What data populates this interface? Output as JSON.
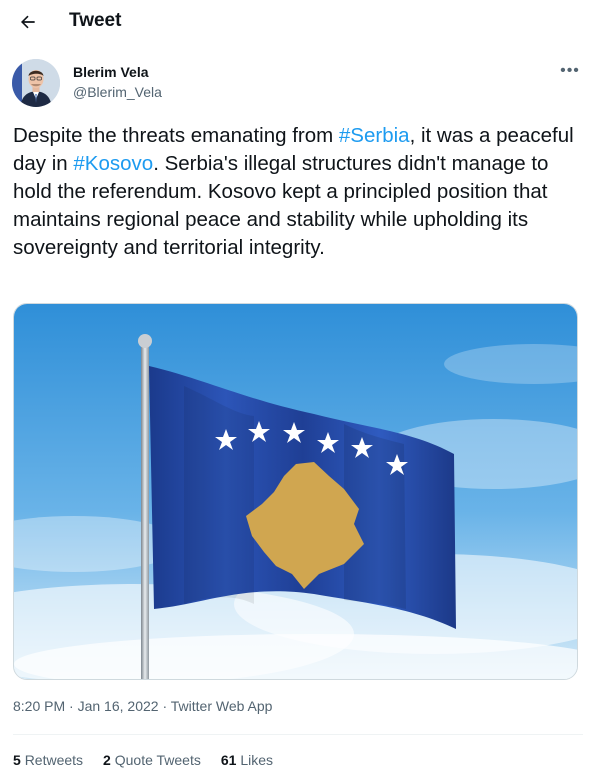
{
  "header": {
    "title": "Tweet",
    "back_icon": "arrow-left-icon"
  },
  "author": {
    "name": "Blerim Vela",
    "handle": "@Blerim_Vela",
    "more_icon": "more-horizontal-icon",
    "more_label": "•••"
  },
  "tweet": {
    "segments": [
      {
        "text": "Despite the threats emanating from ",
        "type": "text"
      },
      {
        "text": "#Serbia",
        "type": "hashtag"
      },
      {
        "text": ", it was a peaceful day in ",
        "type": "text"
      },
      {
        "text": "#Kosovo",
        "type": "hashtag"
      },
      {
        "text": ". Serbia's illegal structures didn't manage to hold the referendum. Kosovo kept a principled position that maintains regional peace and stability while upholding its sovereignty and territorial integrity.",
        "type": "text"
      }
    ]
  },
  "meta": {
    "time": "8:20 PM",
    "sep1": " · ",
    "date": "Jan 16, 2022",
    "sep2": " · ",
    "source": "Twitter Web App"
  },
  "stats": {
    "retweets_count": "5",
    "retweets_label": "Retweets",
    "quotes_count": "2",
    "quotes_label": "Quote Tweets",
    "likes_count": "61",
    "likes_label": "Likes"
  },
  "colors": {
    "accent": "#1d9bf0",
    "text": "#0f1419",
    "secondary": "#536471",
    "flag_blue": "#244aa5",
    "flag_gold": "#d0a650"
  }
}
